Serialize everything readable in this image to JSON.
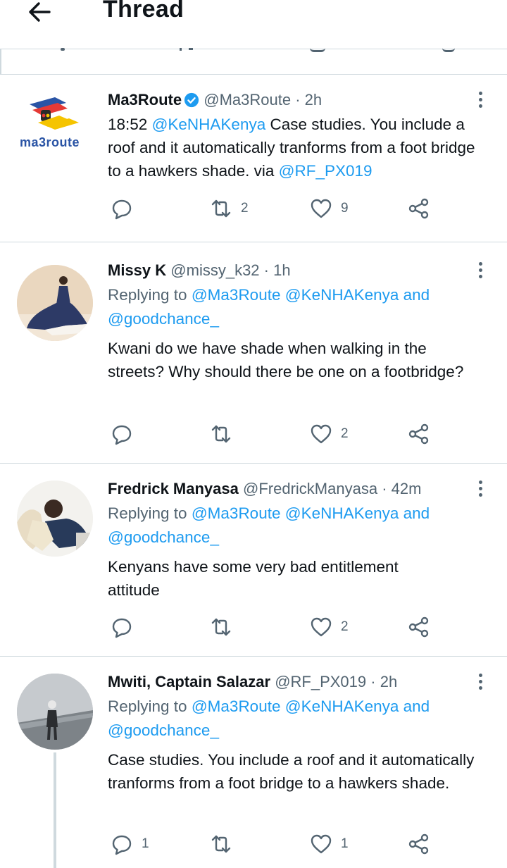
{
  "header": {
    "title": "Thread"
  },
  "tweets": [
    {
      "name": "Ma3Route",
      "handle": "@Ma3Route",
      "time": "· 2h",
      "logo_text": "ma3route",
      "text_prefix": "18:52 ",
      "mention1": "@KeNHAKenya",
      "text_mid": " Case studies. You include a roof and it automatically tranforms from a foot bridge to a hawkers shade. via ",
      "mention2": "@RF_PX019",
      "reply_count": "",
      "retweet_count": "2",
      "like_count": "9"
    },
    {
      "name": "Missy K",
      "handle": "@missy_k32",
      "time": "· 1h",
      "replying_label": "Replying to ",
      "reply_mentions": "@Ma3Route @KeNHAKenya",
      "and_label": " and",
      "reply_extra": "@goodchance_",
      "text": "Kwani do we have shade when walking in the streets? Why should there be one on a footbridge?",
      "reply_count": "",
      "retweet_count": "",
      "like_count": "2"
    },
    {
      "name": "Fredrick Manyasa",
      "handle": "@FredrickManyasa",
      "time": "· 42m",
      "replying_label": "Replying to ",
      "reply_mentions": "@Ma3Route @KeNHAKenya",
      "and_label": " and",
      "reply_extra": "@goodchance_",
      "text": "Kenyans have some very bad entitlement attitude",
      "reply_count": "",
      "retweet_count": "",
      "like_count": "2"
    },
    {
      "name": "Mwiti, Captain Salazar",
      "handle": "@RF_PX019",
      "time": "· 2h",
      "replying_label": "Replying to ",
      "reply_mentions": "@Ma3Route @KeNHAKenya",
      "and_label": " and",
      "reply_extra": "@goodchance_",
      "text": "Case studies. You include a roof and it automatically tranforms from a foot bridge to a hawkers shade.",
      "reply_count": "1",
      "retweet_count": "",
      "like_count": "1"
    }
  ],
  "colors": {
    "accent": "#1d9bf0",
    "muted": "#536471",
    "text": "#0f1419",
    "divider": "#cfd9de",
    "verified": "#1d9bf0"
  },
  "icons": {
    "back": "arrow-left-icon",
    "more": "more-vertical-icon",
    "reply": "reply-icon",
    "retweet": "retweet-icon",
    "like": "heart-icon",
    "share": "share-icon"
  }
}
